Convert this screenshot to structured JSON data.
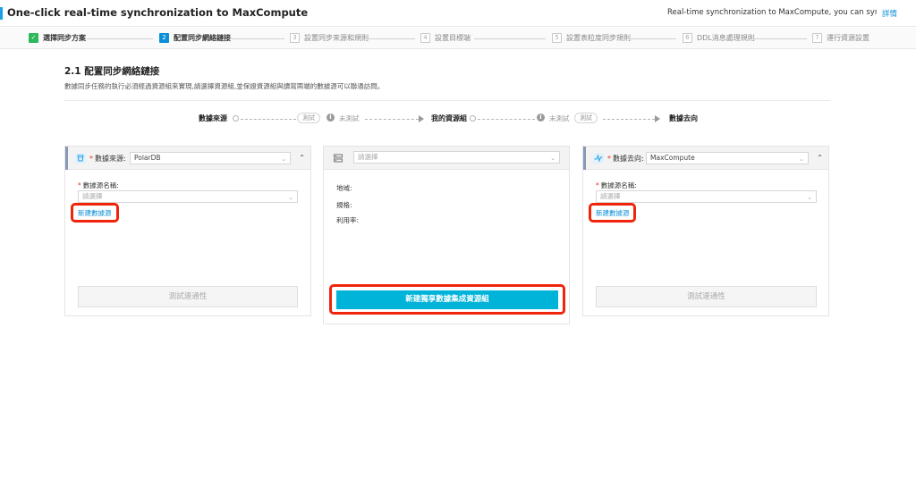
{
  "header": {
    "title": "One-click real-time synchronization to MaxCompute",
    "description": "Real-time synchronization to MaxCompute, you can synchronize the real-ti...",
    "detail_link": "詳情"
  },
  "steps": [
    {
      "num": "✓",
      "label": "選擇同步方案",
      "state": "done"
    },
    {
      "num": "2",
      "label": "配置同步網絡鏈接",
      "state": "active"
    },
    {
      "num": "3",
      "label": "設置同步來源和規則",
      "state": "pending"
    },
    {
      "num": "4",
      "label": "設置目標端",
      "state": "pending"
    },
    {
      "num": "5",
      "label": "設置表粒度同步規則",
      "state": "pending"
    },
    {
      "num": "6",
      "label": "DDL消息處理規則",
      "state": "pending"
    },
    {
      "num": "7",
      "label": "運行資源設置",
      "state": "pending"
    }
  ],
  "section": {
    "title": "2.1 配置同步網絡鏈接",
    "description": "數據同步任務的執行必須經過資源組來實現,請選擇資源組,並保證資源組與讀寫兩端的數據源可以聯通訪問。"
  },
  "flow": {
    "source_label": "數據來源",
    "test_left": "測試",
    "status_left": "未測試",
    "resource_label": "我的資源組",
    "status_right": "未測試",
    "test_right": "測試",
    "target_label": "數據去向"
  },
  "source_panel": {
    "header_label": "數據來源:",
    "source_type": "PolarDB",
    "name_label": "數據源名稱:",
    "name_placeholder": "請選擇",
    "new_link": "新建數據源",
    "test_button": "測試連通性"
  },
  "resource_panel": {
    "select_placeholder": "請選擇",
    "region_label": "地域:",
    "spec_label": "規格:",
    "usage_label": "利用率:",
    "create_button": "新建獨享數據集成資源組"
  },
  "target_panel": {
    "header_label": "數據去向:",
    "target_type": "MaxCompute",
    "name_label": "數據源名稱:",
    "name_placeholder": "請選擇",
    "new_link": "新建數據源",
    "test_button": "測試連通性"
  },
  "colors": {
    "accent": "#0a8fd8",
    "success": "#2eb85c",
    "primary_button": "#00b3d8",
    "highlight": "#f0240a"
  }
}
